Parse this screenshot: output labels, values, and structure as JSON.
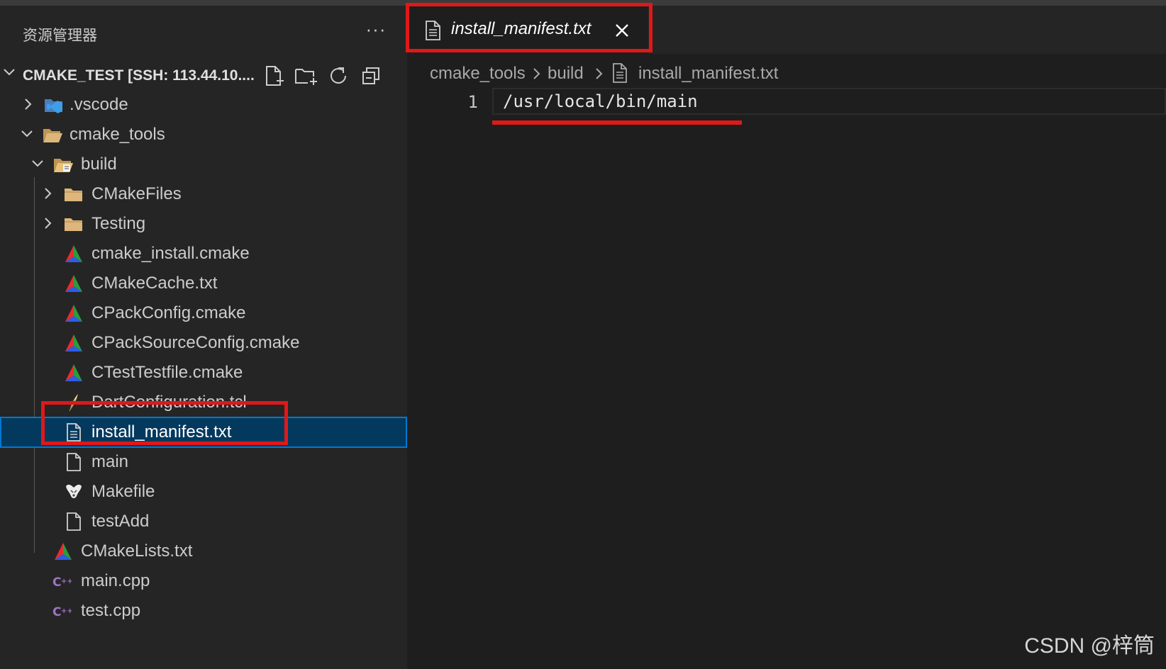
{
  "explorer": {
    "title": "资源管理器",
    "more_label": "···",
    "project_label": "CMAKE_TEST [SSH: 113.44.10....",
    "actions": [
      "new-file-icon",
      "new-folder-icon",
      "refresh-icon",
      "collapse-all-icon"
    ]
  },
  "tree": {
    "vscode": ".vscode",
    "cmake_tools": "cmake_tools",
    "build": "build",
    "cmakefiles": "CMakeFiles",
    "testing": "Testing",
    "cmake_install": "cmake_install.cmake",
    "cmakecache": "CMakeCache.txt",
    "cpackconfig": "CPackConfig.cmake",
    "cpacksourceconfig": "CPackSourceConfig.cmake",
    "ctesttestfile": "CTestTestfile.cmake",
    "dartconfiguration": "DartConfiguration.tcl",
    "install_manifest": "install_manifest.txt",
    "main": "main",
    "makefile": "Makefile",
    "testadd": "testAdd",
    "cmakelists": "CMakeLists.txt",
    "main_cpp": "main.cpp",
    "test_cpp": "test.cpp"
  },
  "editor": {
    "tab_label": "install_manifest.txt",
    "breadcrumbs": [
      "cmake_tools",
      "build",
      "install_manifest.txt"
    ],
    "line_number": "1",
    "line_text": "/usr/local/bin/main"
  },
  "watermark": "CSDN @梓筒",
  "colors": {
    "highlight_red": "#e01818",
    "selection_bg": "#04395e",
    "selection_border": "#0078d4",
    "folder": "#dcb67a"
  }
}
